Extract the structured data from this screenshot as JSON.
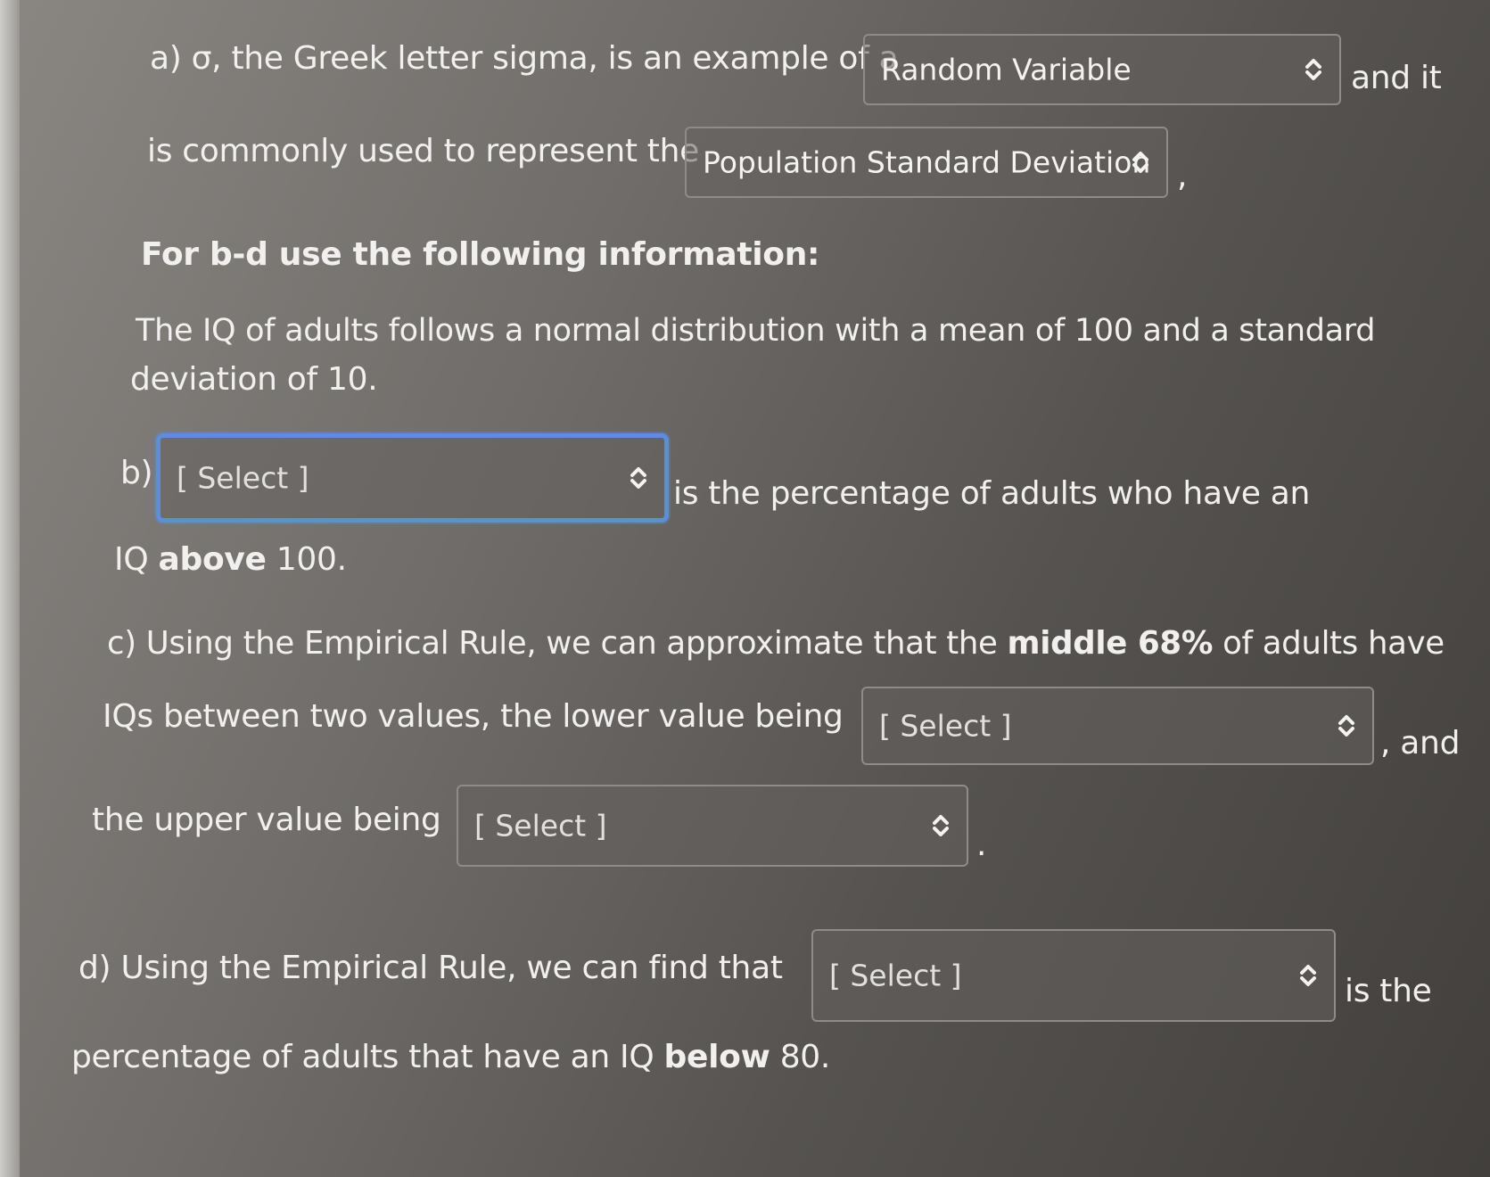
{
  "part_a": {
    "prefix": "a) σ, the Greek letter sigma, is an example of a",
    "select1_value": "Random Variable",
    "middle": "and it",
    "line2_prefix": "is commonly used to represent the",
    "select2_value": "Population Standard Deviation",
    "suffix": ","
  },
  "info": {
    "heading": "For b-d use the following information:",
    "text_line1": "The IQ of adults follows a normal distribution with a mean of 100 and a standard",
    "text_line2": "deviation of 10."
  },
  "part_b": {
    "label": "b)",
    "select_value": "[ Select ]",
    "text_after": "is the percentage of adults who have an",
    "line2_normal1": "IQ ",
    "line2_bold": "above",
    "line2_normal2": " 100."
  },
  "part_c": {
    "line1_normal": "c) Using the Empirical Rule, we can approximate that the ",
    "line1_bold": "middle 68%",
    "line1_end": " of adults have",
    "line2_prefix": "IQs between two values, the lower value being",
    "select_lower_value": "[ Select ]",
    "line2_suffix": ", and",
    "line3_prefix": "the upper value being",
    "select_upper_value": "[ Select ]",
    "line3_suffix": "."
  },
  "part_d": {
    "prefix": "d) Using the Empirical Rule, we can find that",
    "select_value": "[ Select ]",
    "suffix": "is the",
    "line2_normal": "percentage of adults that have an IQ ",
    "line2_bold": "below",
    "line2_end": " 80."
  },
  "icons": {
    "dropdown": "chevron-up-down-icon"
  },
  "colors": {
    "focus_border": "#5b8fdc",
    "select_border": "#8f8c88",
    "text": "#f1f0ee"
  }
}
